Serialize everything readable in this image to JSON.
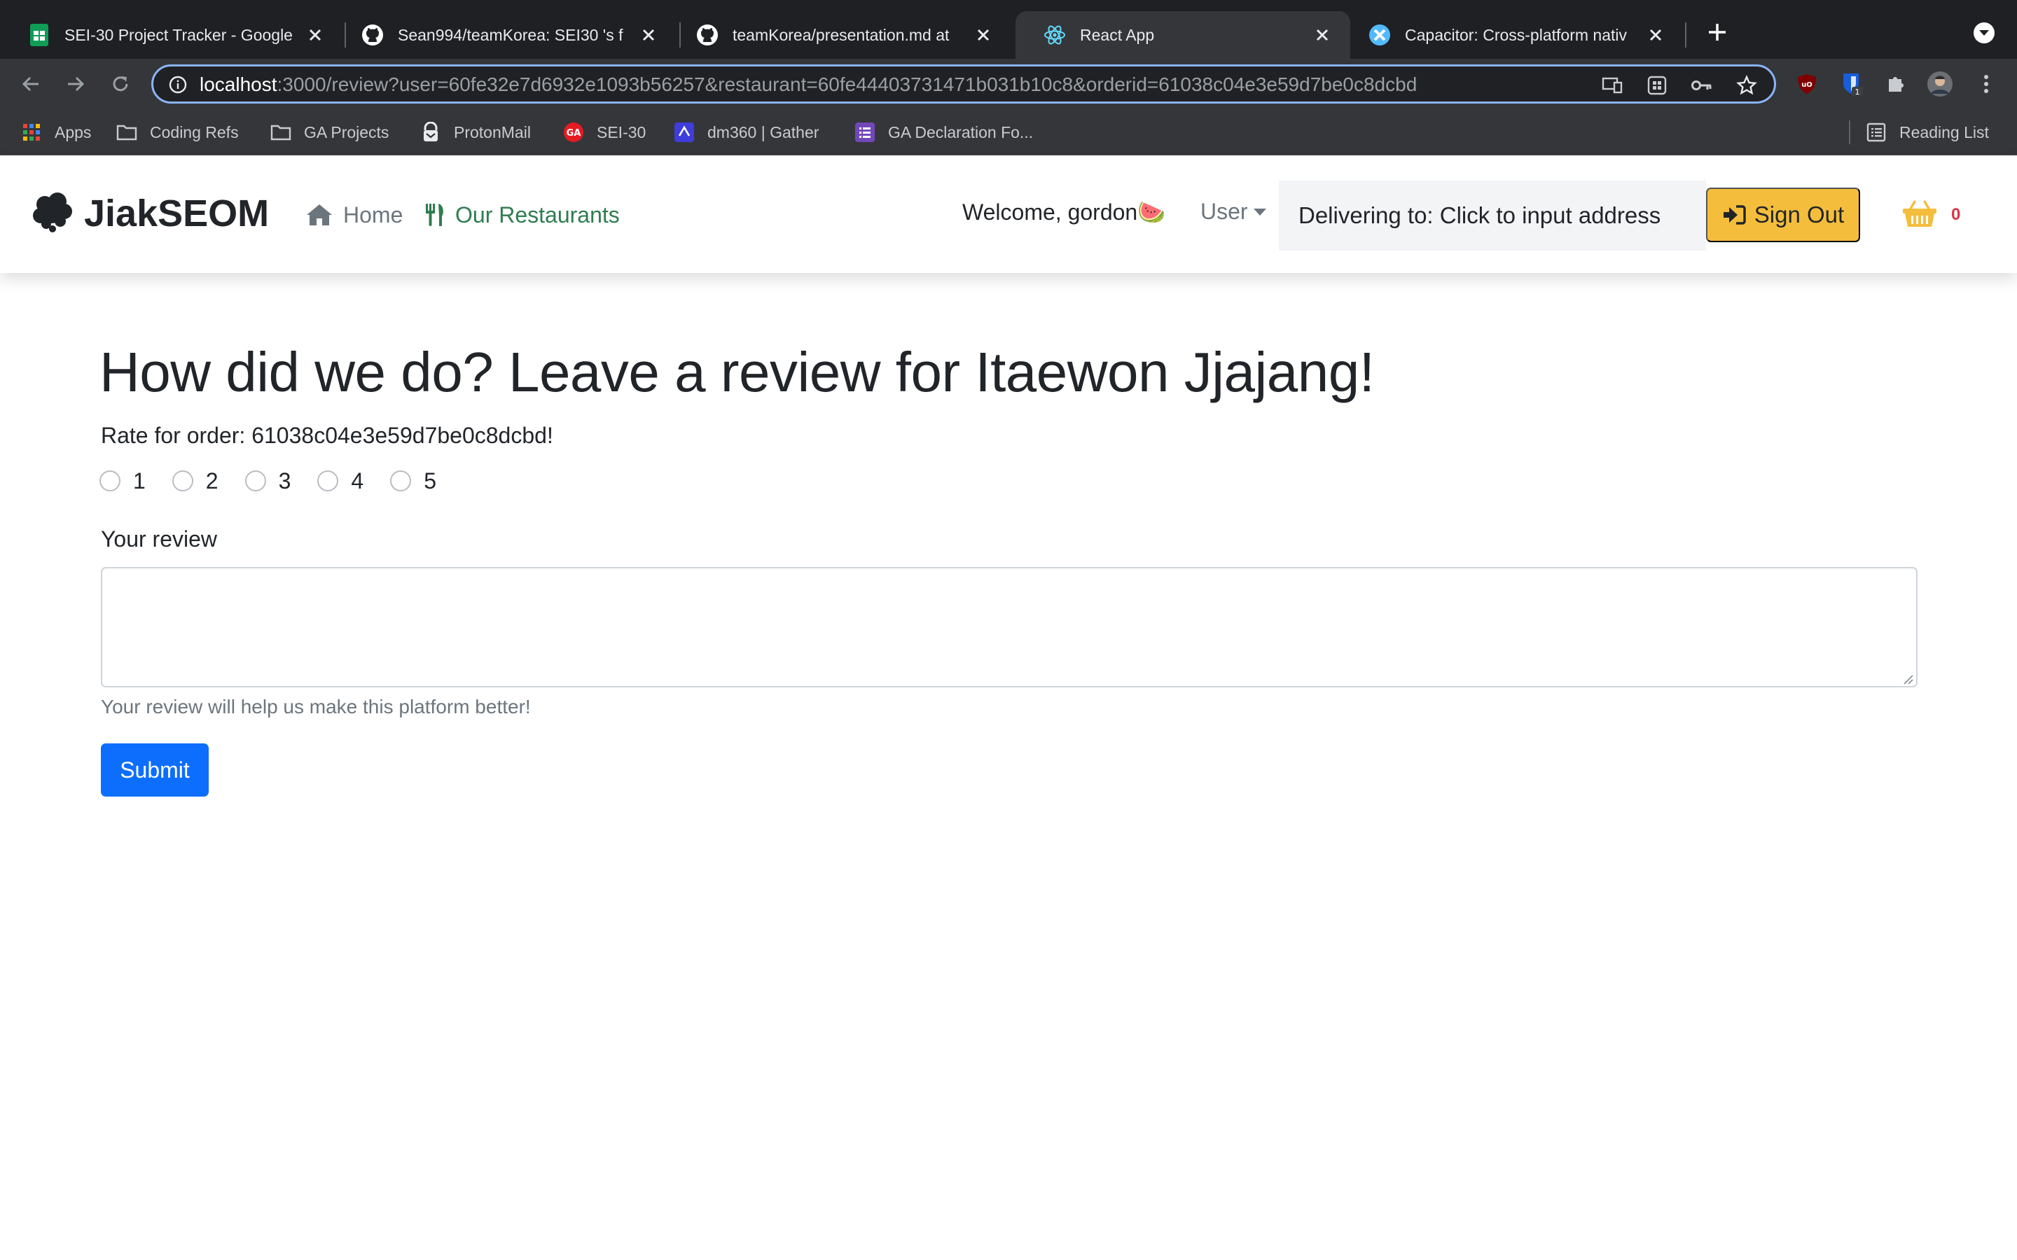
{
  "browser": {
    "tabs": [
      {
        "title": "SEI-30 Project Tracker - Google",
        "favicon": "google-sheets-icon"
      },
      {
        "title": "Sean994/teamKorea: SEI30 's f",
        "favicon": "github-icon"
      },
      {
        "title": "teamKorea/presentation.md at",
        "favicon": "github-icon"
      },
      {
        "title": "React App",
        "favicon": "react-icon",
        "active": true
      },
      {
        "title": "Capacitor: Cross-platform nativ",
        "favicon": "capacitor-icon"
      }
    ],
    "address_bar": {
      "host": "localhost",
      "path": ":3000/review?user=60fe32e7d6932e1093b56257&restaurant=60fe44403731471b031b10c8&orderid=61038c04e3e59d7be0c8dcbd"
    },
    "bookmarks": [
      {
        "label": "Apps",
        "icon": "apps-grid-icon"
      },
      {
        "label": "Coding Refs",
        "icon": "folder-icon"
      },
      {
        "label": "GA Projects",
        "icon": "folder-icon"
      },
      {
        "label": "ProtonMail",
        "icon": "protonmail-icon"
      },
      {
        "label": "SEI-30",
        "icon": "ga-icon"
      },
      {
        "label": "dm360 | Gather",
        "icon": "gather-icon"
      },
      {
        "label": "GA Declaration Fo...",
        "icon": "forms-icon"
      }
    ],
    "reading_list": "Reading List",
    "extension_badge": "1"
  },
  "navbar": {
    "brand": "JiakSEOM",
    "home": "Home",
    "restaurants": "Our Restaurants",
    "welcome": "Welcome, gordon🍉",
    "user_menu": "User",
    "delivery": "Delivering to: Click to input address",
    "sign_out": "Sign Out",
    "cart_count": "0",
    "colors": {
      "accent_green": "#2e7d4f",
      "sign_out_bg": "#f4be3c",
      "cart_icon": "#f4be3c",
      "cart_count": "#dc3545"
    }
  },
  "review": {
    "heading": "How did we do? Leave a review for Itaewon Jjajang!",
    "rate_line": "Rate for order: 61038c04e3e59d7be0c8dcbd!",
    "ratings": [
      "1",
      "2",
      "3",
      "4",
      "5"
    ],
    "label": "Your review",
    "textarea_value": "",
    "help": "Your review will help us make this platform better!",
    "submit": "Submit",
    "submit_color": "#0d6efd"
  }
}
